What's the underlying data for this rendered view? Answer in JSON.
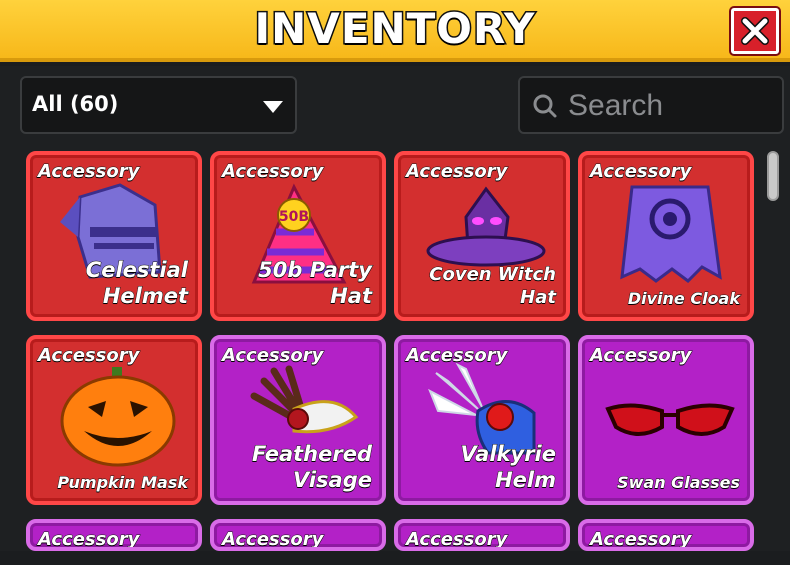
{
  "header": {
    "title": "INVENTORY",
    "close_icon": "close-x-icon",
    "colors": {
      "bar": "#f7b81a",
      "close": "#d8202a"
    }
  },
  "filter": {
    "selected": "All (60)",
    "arrow_icon": "chevron-down-icon"
  },
  "search": {
    "placeholder": "Search",
    "value": "",
    "icon": "search-icon"
  },
  "items": [
    {
      "category": "Accessory",
      "name": "Celestial\nHelmet",
      "rarity_color": "#d32f2f",
      "icon": "helmet-icon"
    },
    {
      "category": "Accessory",
      "name": "50b Party\nHat",
      "rarity_color": "#d32f2f",
      "icon": "party-hat-icon",
      "hat_label": "50B"
    },
    {
      "category": "Accessory",
      "name": "Coven Witch\nHat",
      "rarity_color": "#d32f2f",
      "icon": "witch-hat-icon"
    },
    {
      "category": "Accessory",
      "name": "Divine Cloak",
      "rarity_color": "#d32f2f",
      "icon": "cloak-icon"
    },
    {
      "category": "Accessory",
      "name": "Pumpkin Mask",
      "rarity_color": "#d32f2f",
      "icon": "pumpkin-icon"
    },
    {
      "category": "Accessory",
      "name": "Feathered\nVisage",
      "rarity_color": "#b321c7",
      "icon": "feather-mask-icon"
    },
    {
      "category": "Accessory",
      "name": "Valkyrie\nHelm",
      "rarity_color": "#b321c7",
      "icon": "winged-helm-icon"
    },
    {
      "category": "Accessory",
      "name": "Swan Glasses",
      "rarity_color": "#b321c7",
      "icon": "glasses-icon"
    },
    {
      "category": "Accessory",
      "name": "",
      "rarity_color": "#b321c7",
      "icon": ""
    },
    {
      "category": "Accessory",
      "name": "",
      "rarity_color": "#b321c7",
      "icon": ""
    },
    {
      "category": "Accessory",
      "name": "",
      "rarity_color": "#b321c7",
      "icon": ""
    },
    {
      "category": "Accessory",
      "name": "",
      "rarity_color": "#b321c7",
      "icon": ""
    }
  ]
}
